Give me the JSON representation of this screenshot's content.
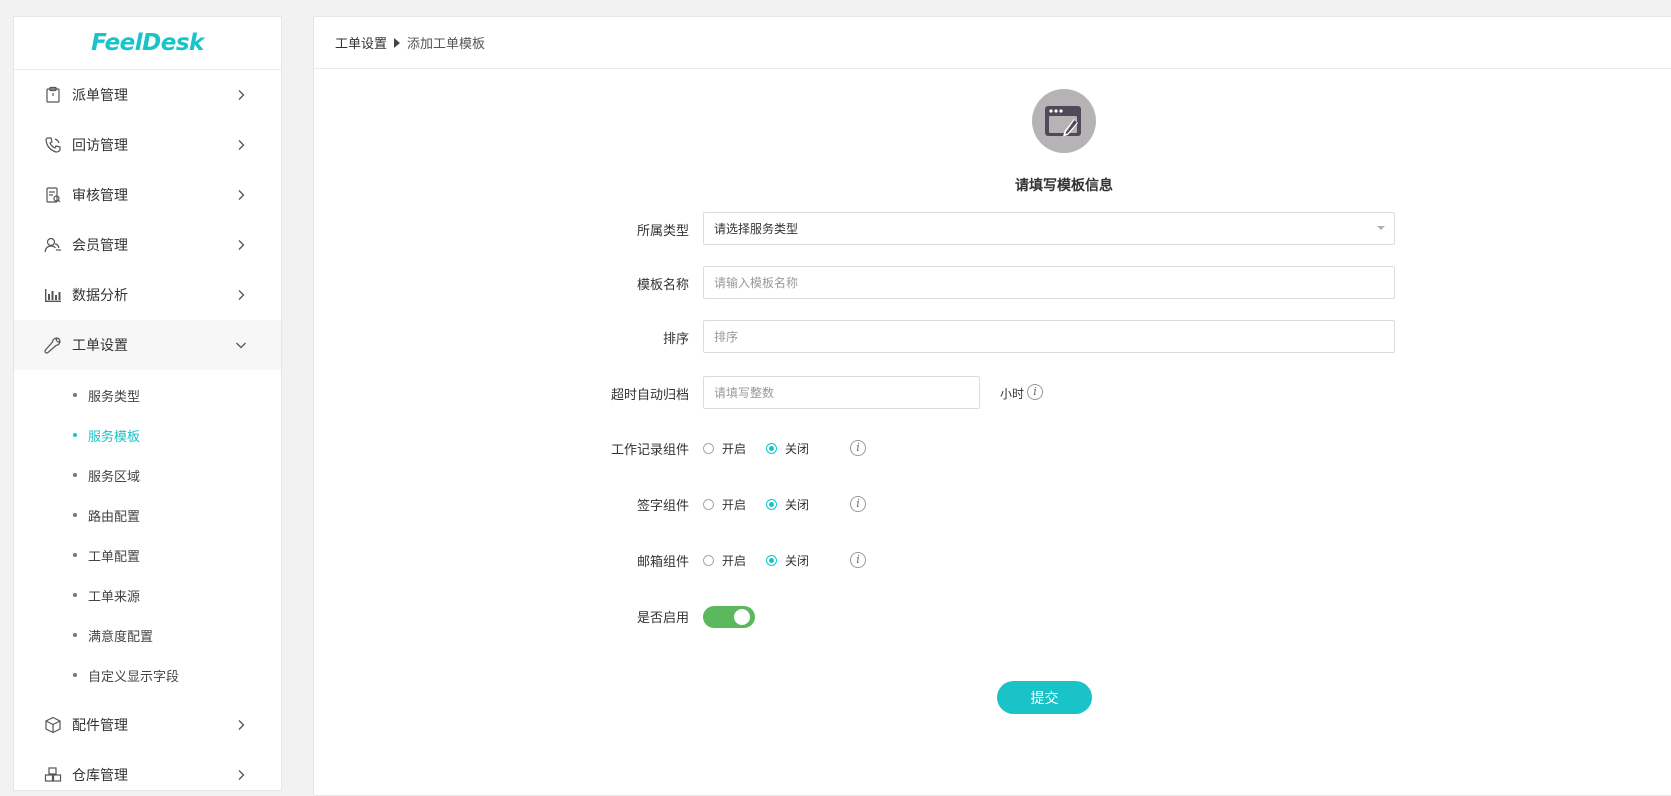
{
  "brand": {
    "logo_text": "FeelDesk"
  },
  "sidebar": {
    "menus": [
      {
        "label": "派单管理",
        "icon": "clipboard-icon"
      },
      {
        "label": "回访管理",
        "icon": "phone-icon"
      },
      {
        "label": "审核管理",
        "icon": "audit-document-icon"
      },
      {
        "label": "会员管理",
        "icon": "members-icon"
      },
      {
        "label": "数据分析",
        "icon": "bar-chart-icon"
      },
      {
        "label": "工单设置",
        "icon": "wrench-icon",
        "expanded": true
      },
      {
        "label": "配件管理",
        "icon": "box-icon"
      },
      {
        "label": "仓库管理",
        "icon": "warehouse-icon"
      }
    ],
    "submenu": [
      {
        "label": "服务类型"
      },
      {
        "label": "服务模板",
        "active": true
      },
      {
        "label": "服务区域"
      },
      {
        "label": "路由配置"
      },
      {
        "label": "工单配置"
      },
      {
        "label": "工单来源"
      },
      {
        "label": "满意度配置"
      },
      {
        "label": "自定义显示字段"
      }
    ]
  },
  "breadcrumb": {
    "parent": "工单设置",
    "current": "添加工单模板"
  },
  "form": {
    "title": "请填写模板信息",
    "type": {
      "label": "所属类型",
      "value": "请选择服务类型"
    },
    "name": {
      "label": "模板名称",
      "placeholder": "请输入模板名称"
    },
    "sort": {
      "label": "排序",
      "placeholder": "排序"
    },
    "timeout": {
      "label": "超时自动归档",
      "placeholder": "请填写整数",
      "unit": "小时"
    },
    "work_record": {
      "label": "工作记录组件",
      "on": "开启",
      "off": "关闭",
      "value": "off"
    },
    "signature": {
      "label": "签字组件",
      "on": "开启",
      "off": "关闭",
      "value": "off"
    },
    "mailbox": {
      "label": "邮箱组件",
      "on": "开启",
      "off": "关闭",
      "value": "off"
    },
    "enabled": {
      "label": "是否启用",
      "value": true
    },
    "submit_label": "提交"
  },
  "colors": {
    "accent": "#19c3c8",
    "toggle_on": "#5cb85c"
  }
}
